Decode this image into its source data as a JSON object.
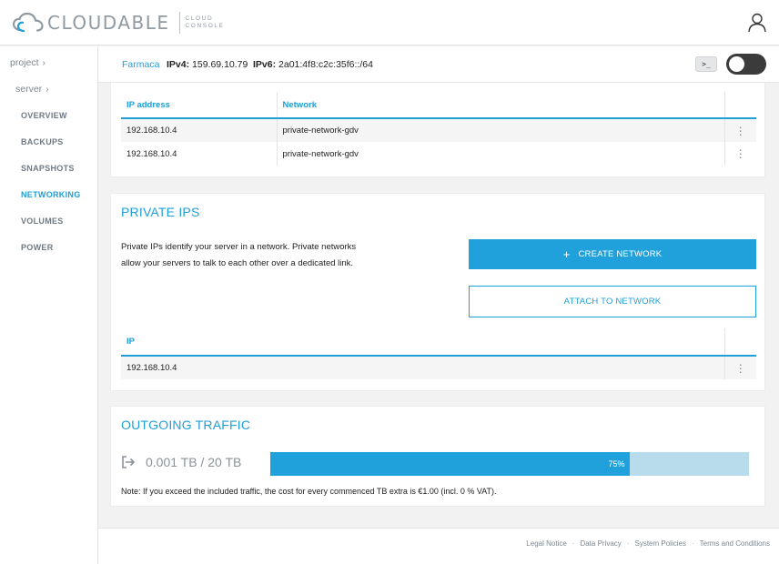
{
  "brand": {
    "name": "CLOUDABLE",
    "sub_line1": "CLOUD",
    "sub_line2": "CONSOLE"
  },
  "sidebar": {
    "breadcrumbs": [
      {
        "label": "project",
        "icon": "chevron-right-icon"
      },
      {
        "label": "server",
        "icon": "chevron-right-icon"
      }
    ],
    "items": [
      {
        "label": "OVERVIEW",
        "active": false
      },
      {
        "label": "BACKUPS",
        "active": false
      },
      {
        "label": "SNAPSHOTS",
        "active": false
      },
      {
        "label": "NETWORKING",
        "active": true
      },
      {
        "label": "VOLUMES",
        "active": false
      },
      {
        "label": "POWER",
        "active": false
      }
    ]
  },
  "server": {
    "name": "Farmaca",
    "ipv4_label": "IPv4:",
    "ipv4": "159.69.10.79",
    "ipv6_label": "IPv6:",
    "ipv6": "2a01:4f8:c2c:35f6::/64",
    "console_label": ">_",
    "power_on": false
  },
  "network_table": {
    "headers": [
      "IP address",
      "Network"
    ],
    "rows": [
      {
        "ip": "192.168.10.4",
        "network": "private-network-gdv"
      },
      {
        "ip": "192.168.10.4",
        "network": "private-network-gdv"
      }
    ]
  },
  "private_ips": {
    "title": "PRIVATE IPS",
    "description": "Private IPs identify your server in a network. Private networks allow your servers to talk to each other over a dedicated link.",
    "create_button": "CREATE NETWORK",
    "create_icon": "plus-icon",
    "attach_button": "ATTACH TO NETWORK",
    "table": {
      "headers": [
        "IP"
      ],
      "rows": [
        {
          "ip": "192.168.10.4"
        }
      ]
    }
  },
  "traffic": {
    "title": "OUTGOING TRAFFIC",
    "icon": "sign-out-icon",
    "usage": "0.001 TB / 20 TB",
    "percent": 75,
    "percent_label": "75%",
    "note": "Note: If you exceed the included traffic, the cost for every commenced TB extra is €1.00 (incl. 0 % VAT)."
  },
  "footer": {
    "links": [
      "Legal Notice",
      "Data Privacy",
      "System Policies",
      "Terms and Conditions"
    ],
    "separator": "·"
  },
  "colors": {
    "accent": "#1f9fd7",
    "button": "#21a1db",
    "bar_track": "#b8dceb",
    "toggle": "#3b3b3b"
  }
}
